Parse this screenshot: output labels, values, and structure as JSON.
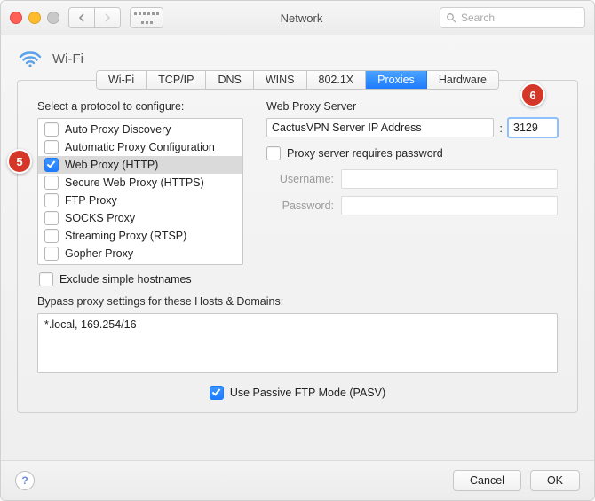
{
  "titlebar": {
    "title": "Network",
    "search_placeholder": "Search"
  },
  "header": {
    "connection": "Wi-Fi"
  },
  "tabs": [
    "Wi-Fi",
    "TCP/IP",
    "DNS",
    "WINS",
    "802.1X",
    "Proxies",
    "Hardware"
  ],
  "active_tab": "Proxies",
  "left": {
    "label": "Select a protocol to configure:",
    "protocols": [
      {
        "label": "Auto Proxy Discovery",
        "checked": false,
        "selected": false
      },
      {
        "label": "Automatic Proxy Configuration",
        "checked": false,
        "selected": false
      },
      {
        "label": "Web Proxy (HTTP)",
        "checked": true,
        "selected": true
      },
      {
        "label": "Secure Web Proxy (HTTPS)",
        "checked": false,
        "selected": false
      },
      {
        "label": "FTP Proxy",
        "checked": false,
        "selected": false
      },
      {
        "label": "SOCKS Proxy",
        "checked": false,
        "selected": false
      },
      {
        "label": "Streaming Proxy (RTSP)",
        "checked": false,
        "selected": false
      },
      {
        "label": "Gopher Proxy",
        "checked": false,
        "selected": false
      }
    ],
    "exclude_label": "Exclude simple hostnames",
    "exclude_checked": false
  },
  "right": {
    "label": "Web Proxy Server",
    "server": "CactusVPN Server IP Address",
    "port": "3129",
    "auth_label": "Proxy server requires password",
    "auth_checked": false,
    "username_label": "Username:",
    "username": "",
    "password_label": "Password:",
    "password": ""
  },
  "bypass": {
    "label": "Bypass proxy settings for these Hosts & Domains:",
    "value": "*.local, 169.254/16"
  },
  "pasv": {
    "label": "Use Passive FTP Mode (PASV)",
    "checked": true
  },
  "footer": {
    "help": "?",
    "cancel": "Cancel",
    "ok": "OK"
  },
  "annotations": {
    "five": "5",
    "six": "6"
  }
}
